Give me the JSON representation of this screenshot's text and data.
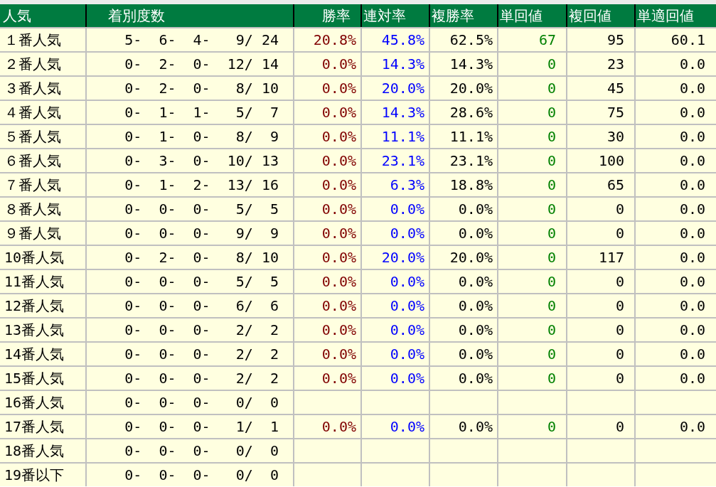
{
  "table": {
    "columns": [
      "人気",
      "着別度数",
      "勝率",
      "連対率",
      "複勝率",
      "単回値",
      "複回値",
      "単適回値"
    ],
    "rows": [
      {
        "label": "１番人気",
        "record": "5-  6-  4-   9/ 24",
        "cells": [
          "20.8%",
          "45.8%",
          "62.5%",
          "67",
          "95",
          "60.1"
        ]
      },
      {
        "label": "２番人気",
        "record": "0-  2-  0-  12/ 14",
        "cells": [
          "0.0%",
          "14.3%",
          "14.3%",
          "0",
          "23",
          "0.0"
        ]
      },
      {
        "label": "３番人気",
        "record": "0-  2-  0-   8/ 10",
        "cells": [
          "0.0%",
          "20.0%",
          "20.0%",
          "0",
          "45",
          "0.0"
        ]
      },
      {
        "label": "４番人気",
        "record": "0-  1-  1-   5/  7",
        "cells": [
          "0.0%",
          "14.3%",
          "28.6%",
          "0",
          "75",
          "0.0"
        ]
      },
      {
        "label": "５番人気",
        "record": "0-  1-  0-   8/  9",
        "cells": [
          "0.0%",
          "11.1%",
          "11.1%",
          "0",
          "30",
          "0.0"
        ]
      },
      {
        "label": "６番人気",
        "record": "0-  3-  0-  10/ 13",
        "cells": [
          "0.0%",
          "23.1%",
          "23.1%",
          "0",
          "100",
          "0.0"
        ]
      },
      {
        "label": "７番人気",
        "record": "0-  1-  2-  13/ 16",
        "cells": [
          "0.0%",
          "6.3%",
          "18.8%",
          "0",
          "65",
          "0.0"
        ]
      },
      {
        "label": "８番人気",
        "record": "0-  0-  0-   5/  5",
        "cells": [
          "0.0%",
          "0.0%",
          "0.0%",
          "0",
          "0",
          "0.0"
        ]
      },
      {
        "label": "９番人気",
        "record": "0-  0-  0-   9/  9",
        "cells": [
          "0.0%",
          "0.0%",
          "0.0%",
          "0",
          "0",
          "0.0"
        ]
      },
      {
        "label": "10番人気",
        "record": "0-  2-  0-   8/ 10",
        "cells": [
          "0.0%",
          "20.0%",
          "20.0%",
          "0",
          "117",
          "0.0"
        ]
      },
      {
        "label": "11番人気",
        "record": "0-  0-  0-   5/  5",
        "cells": [
          "0.0%",
          "0.0%",
          "0.0%",
          "0",
          "0",
          "0.0"
        ]
      },
      {
        "label": "12番人気",
        "record": "0-  0-  0-   6/  6",
        "cells": [
          "0.0%",
          "0.0%",
          "0.0%",
          "0",
          "0",
          "0.0"
        ]
      },
      {
        "label": "13番人気",
        "record": "0-  0-  0-   2/  2",
        "cells": [
          "0.0%",
          "0.0%",
          "0.0%",
          "0",
          "0",
          "0.0"
        ]
      },
      {
        "label": "14番人気",
        "record": "0-  0-  0-   2/  2",
        "cells": [
          "0.0%",
          "0.0%",
          "0.0%",
          "0",
          "0",
          "0.0"
        ]
      },
      {
        "label": "15番人気",
        "record": "0-  0-  0-   2/  2",
        "cells": [
          "0.0%",
          "0.0%",
          "0.0%",
          "0",
          "0",
          "0.0"
        ]
      },
      {
        "label": "16番人気",
        "record": "0-  0-  0-   0/  0"
      },
      {
        "label": "17番人気",
        "record": "0-  0-  0-   1/  1",
        "cells": [
          "0.0%",
          "0.0%",
          "0.0%",
          "0",
          "0",
          "0.0"
        ]
      },
      {
        "label": "18番人気",
        "record": "0-  0-  0-   0/  0"
      },
      {
        "label": "19番以下",
        "record": "0-  0-  0-   0/  0"
      }
    ]
  }
}
